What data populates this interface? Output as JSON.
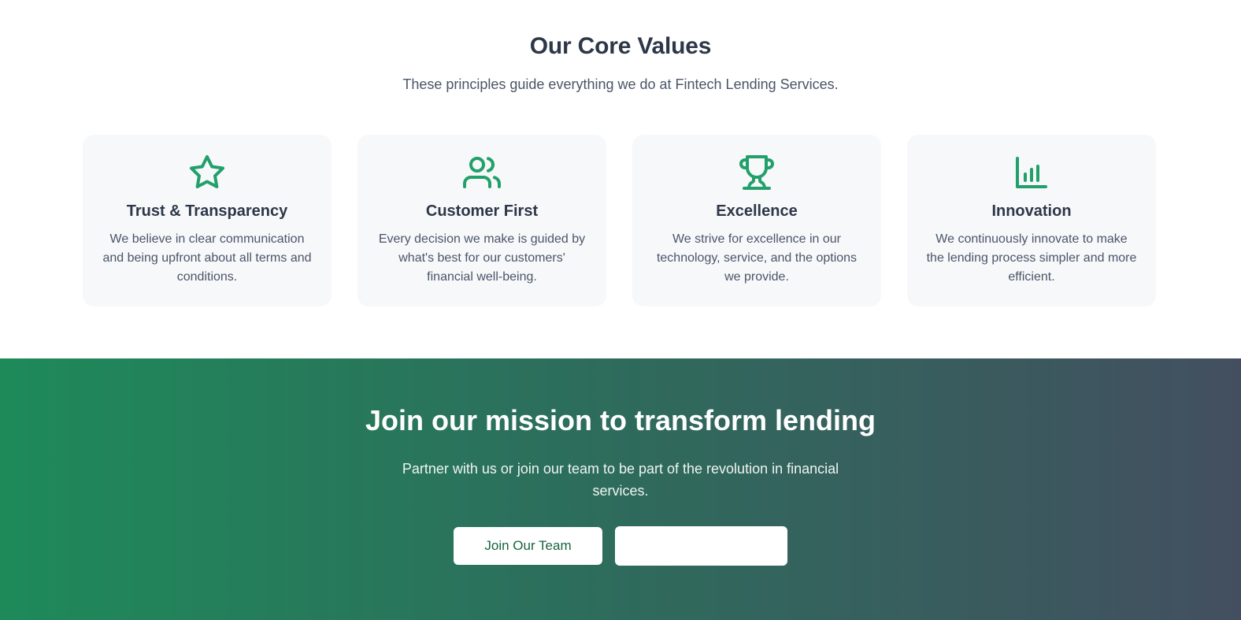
{
  "values_section": {
    "title": "Our Core Values",
    "subtitle": "These principles guide everything we do at Fintech Lending Services.",
    "cards": [
      {
        "icon": "star-icon",
        "title": "Trust & Transparency",
        "text": "We believe in clear communication and being upfront about all terms and conditions."
      },
      {
        "icon": "users-icon",
        "title": "Customer First",
        "text": "Every decision we make is guided by what's best for our customers' financial well-being."
      },
      {
        "icon": "trophy-icon",
        "title": "Excellence",
        "text": "We strive for excellence in our technology, service, and the options we provide."
      },
      {
        "icon": "bar-chart-icon",
        "title": "Innovation",
        "text": "We continuously innovate to make the lending process simpler and more efficient."
      }
    ]
  },
  "cta_section": {
    "title": "Join our mission to transform lending",
    "subtitle": "Partner with us or join our team to be part of the revolution in financial services.",
    "primary_button": "Join Our Team",
    "secondary_button": ""
  },
  "colors": {
    "accent_green": "#22a06b",
    "gradient_start": "#1e8a5a",
    "gradient_end": "#434f60"
  }
}
